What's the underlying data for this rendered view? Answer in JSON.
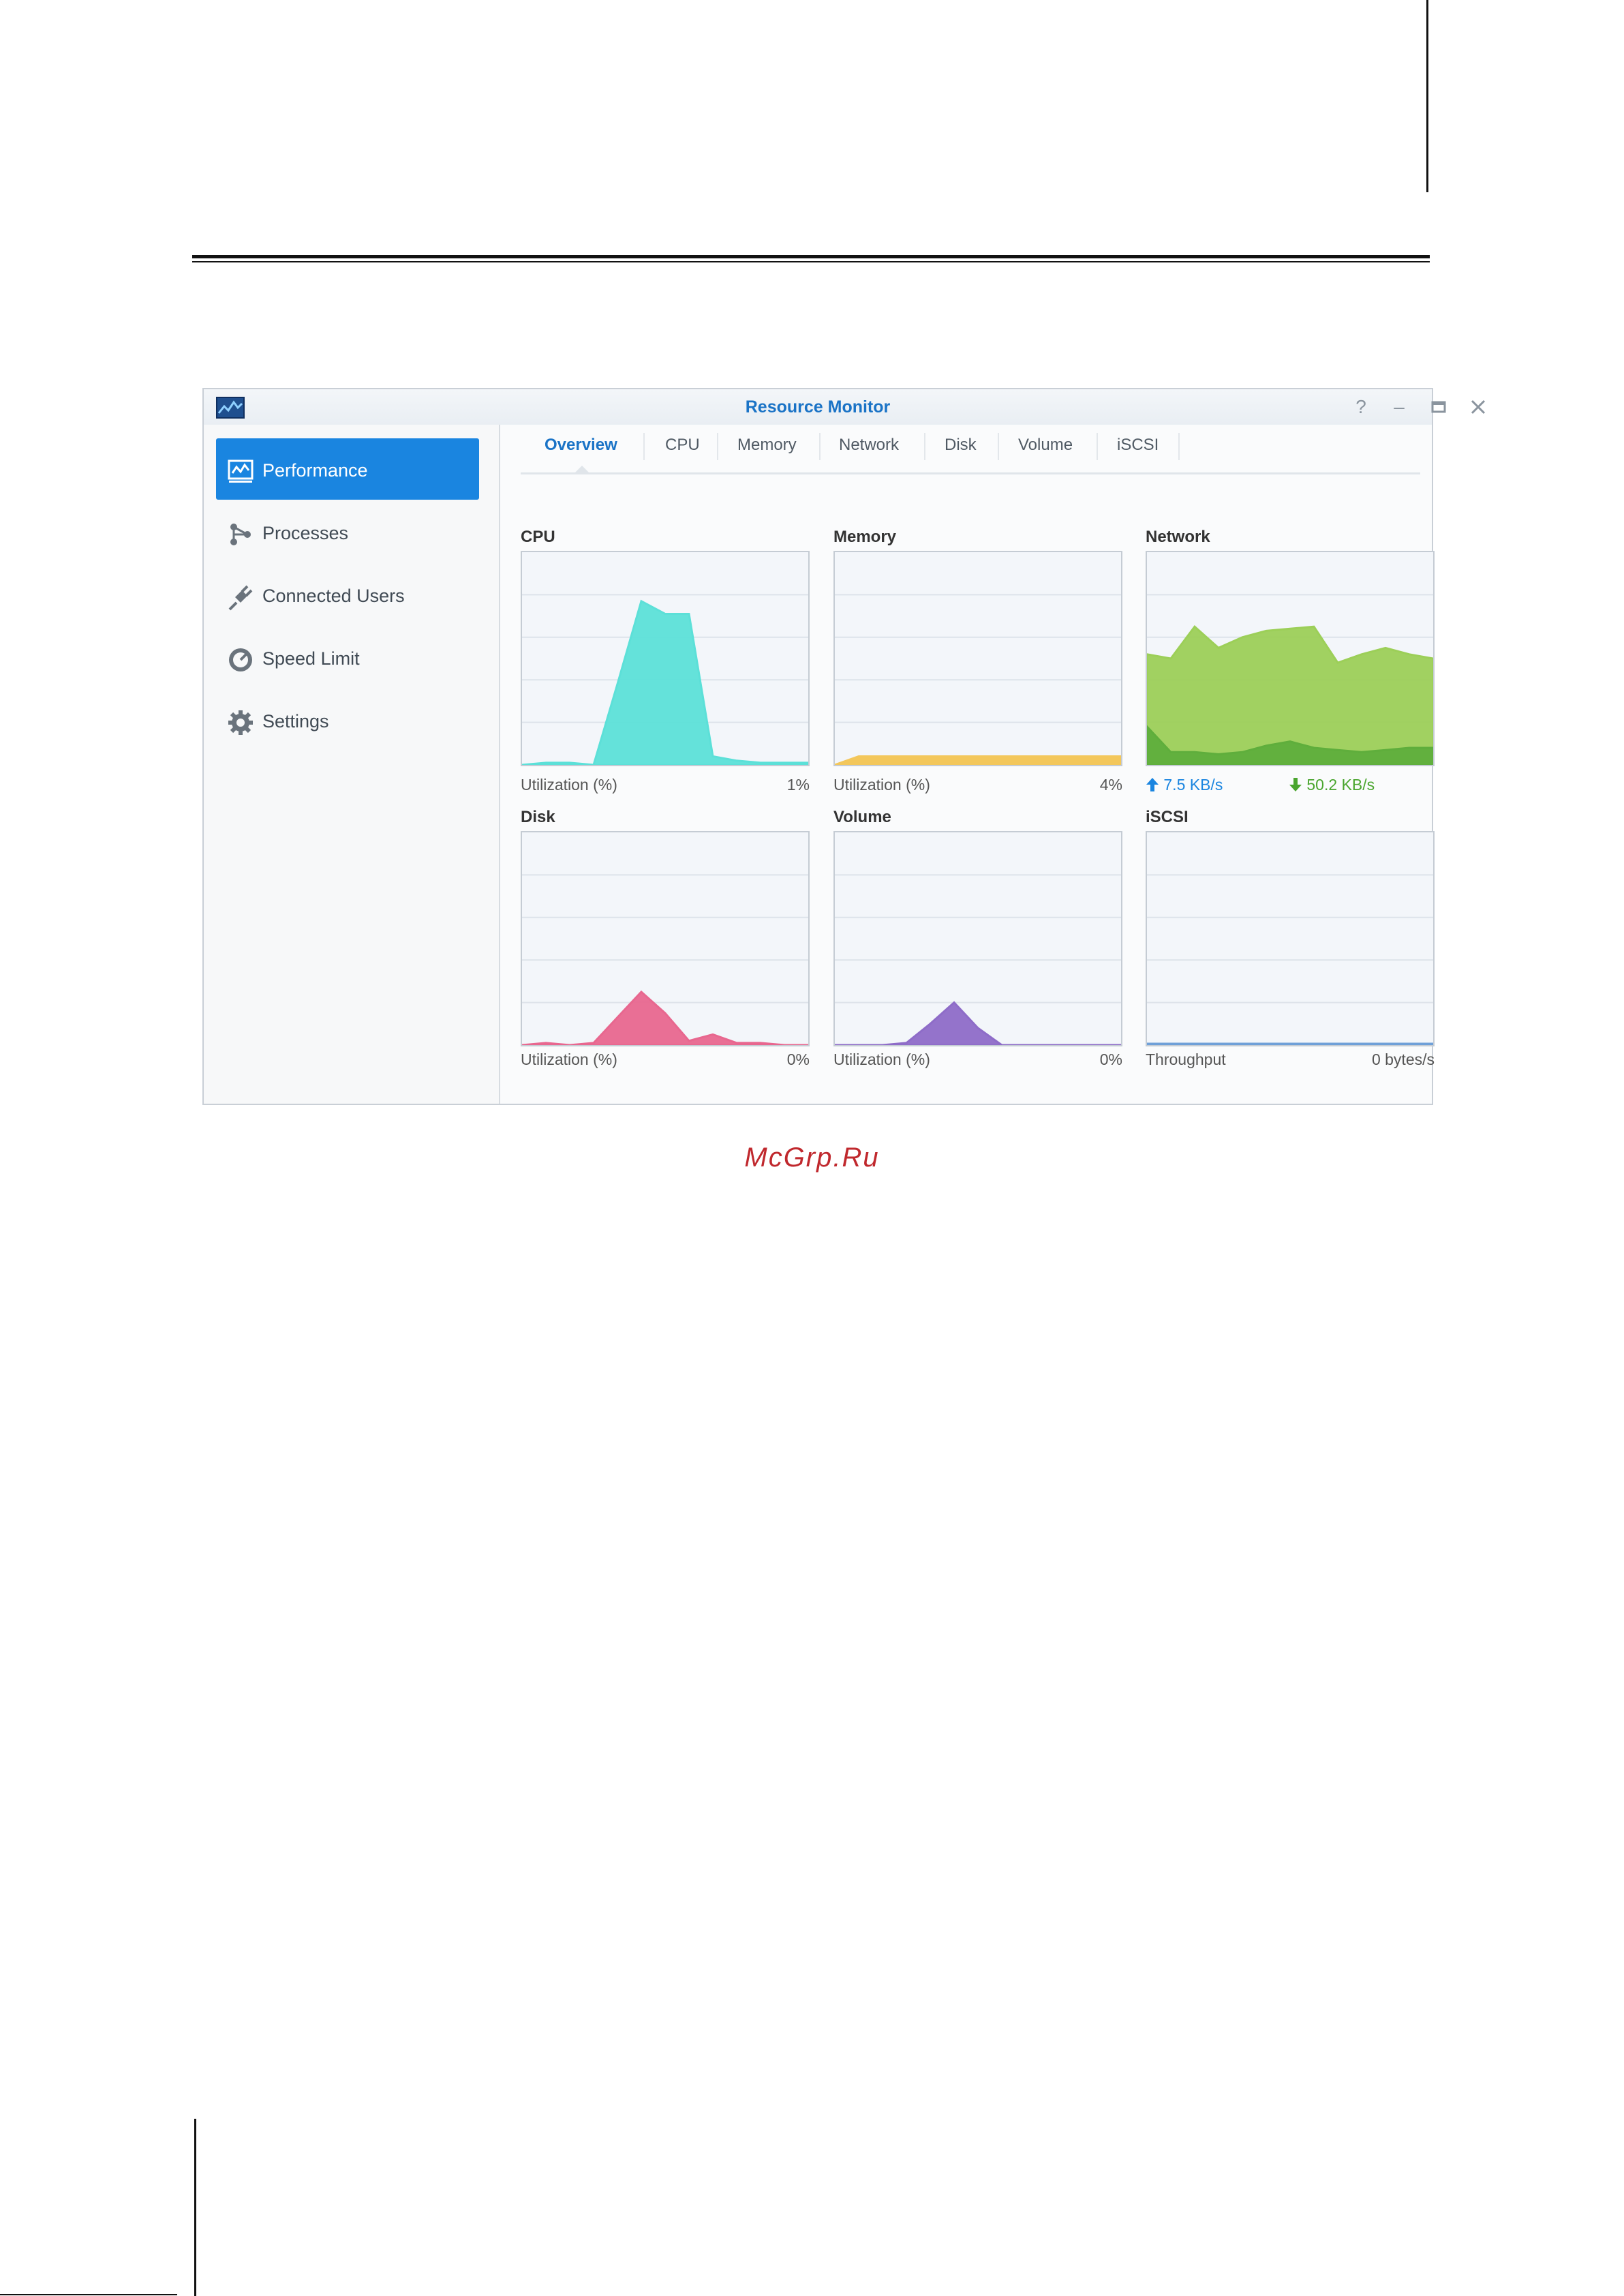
{
  "window": {
    "title": "Resource Monitor",
    "controls": {
      "help": "help-icon",
      "minimize": "minimize-icon",
      "maximize": "maximize-icon",
      "close": "close-icon"
    }
  },
  "sidebar": {
    "items": [
      {
        "label": "Performance",
        "icon": "performance-icon",
        "active": true
      },
      {
        "label": "Processes",
        "icon": "processes-icon",
        "active": false
      },
      {
        "label": "Connected Users",
        "icon": "plug-icon",
        "active": false
      },
      {
        "label": "Speed Limit",
        "icon": "speedometer-icon",
        "active": false
      },
      {
        "label": "Settings",
        "icon": "gear-icon",
        "active": false
      }
    ]
  },
  "tabs": [
    {
      "label": "Overview",
      "active": true
    },
    {
      "label": "CPU",
      "active": false
    },
    {
      "label": "Memory",
      "active": false
    },
    {
      "label": "Network",
      "active": false
    },
    {
      "label": "Disk",
      "active": false
    },
    {
      "label": "Volume",
      "active": false
    },
    {
      "label": "iSCSI",
      "active": false
    }
  ],
  "panels": {
    "cpu": {
      "title": "CPU",
      "footer_label": "Utilization (%)",
      "value": "1%",
      "color": "#5ce0d8"
    },
    "memory": {
      "title": "Memory",
      "footer_label": "Utilization (%)",
      "value": "4%",
      "color": "#f3c75b"
    },
    "network": {
      "title": "Network",
      "upload": "7.5 KB/s",
      "download": "50.2 KB/s",
      "color_up": "#1a85e0",
      "color_down": "#8fcb4c"
    },
    "disk": {
      "title": "Disk",
      "footer_label": "Utilization (%)",
      "value": "0%",
      "color": "#e8678f"
    },
    "volume": {
      "title": "Volume",
      "footer_label": "Utilization (%)",
      "value": "0%",
      "color": "#8e6cc8"
    },
    "iscsi": {
      "title": "iSCSI",
      "footer_label": "Throughput",
      "value": "0 bytes/s",
      "color": "#6fa0d8"
    }
  },
  "chart_data": [
    {
      "type": "area",
      "name_ref": "CPU",
      "ylim": [
        0,
        100
      ],
      "x": [
        0,
        1,
        2,
        3,
        4,
        5,
        6,
        7,
        8,
        9,
        10,
        11,
        12
      ],
      "series": [
        {
          "values": [
            0,
            1,
            1,
            0,
            38,
            77,
            71,
            71,
            4,
            2,
            1,
            1,
            1
          ]
        }
      ]
    },
    {
      "type": "area",
      "name_ref": "Memory",
      "ylim": [
        0,
        100
      ],
      "x": [
        0,
        1,
        2,
        3,
        4,
        5,
        6,
        7,
        8,
        9,
        10,
        11,
        12
      ],
      "series": [
        {
          "values": [
            0,
            4,
            4,
            4,
            4,
            4,
            4,
            4,
            4,
            4,
            4,
            4,
            4
          ]
        }
      ]
    },
    {
      "type": "area",
      "name_ref": "Network",
      "ylim": [
        0,
        100
      ],
      "x": [
        0,
        1,
        2,
        3,
        4,
        5,
        6,
        7,
        8,
        9,
        10,
        11,
        12
      ],
      "series": [
        {
          "values": [
            52,
            50,
            65,
            55,
            60,
            63,
            64,
            65,
            48,
            52,
            55,
            52,
            50
          ]
        },
        {
          "values": [
            18,
            6,
            6,
            5,
            6,
            9,
            11,
            8,
            7,
            6,
            7,
            8,
            8
          ]
        }
      ]
    },
    {
      "type": "area",
      "name_ref": "Disk",
      "ylim": [
        0,
        100
      ],
      "x": [
        0,
        1,
        2,
        3,
        4,
        5,
        6,
        7,
        8,
        9,
        10,
        11,
        12
      ],
      "series": [
        {
          "values": [
            0,
            1,
            0,
            1,
            13,
            25,
            15,
            2,
            5,
            1,
            1,
            0,
            0
          ]
        }
      ]
    },
    {
      "type": "area",
      "name_ref": "Volume",
      "ylim": [
        0,
        100
      ],
      "x": [
        0,
        1,
        2,
        3,
        4,
        5,
        6,
        7,
        8,
        9,
        10,
        11,
        12
      ],
      "series": [
        {
          "values": [
            0,
            0,
            0,
            1,
            10,
            20,
            8,
            0,
            0,
            0,
            0,
            0,
            0
          ]
        }
      ]
    },
    {
      "type": "area",
      "name_ref": "iSCSI",
      "ylim": [
        0,
        100
      ],
      "x": [
        0,
        1,
        2,
        3,
        4,
        5,
        6,
        7,
        8,
        9,
        10,
        11,
        12
      ],
      "series": [
        {
          "values": [
            0,
            0,
            0,
            0,
            0,
            0,
            0,
            0,
            0,
            0,
            0,
            0,
            0
          ]
        }
      ]
    }
  ],
  "watermark": "McGrp.Ru"
}
